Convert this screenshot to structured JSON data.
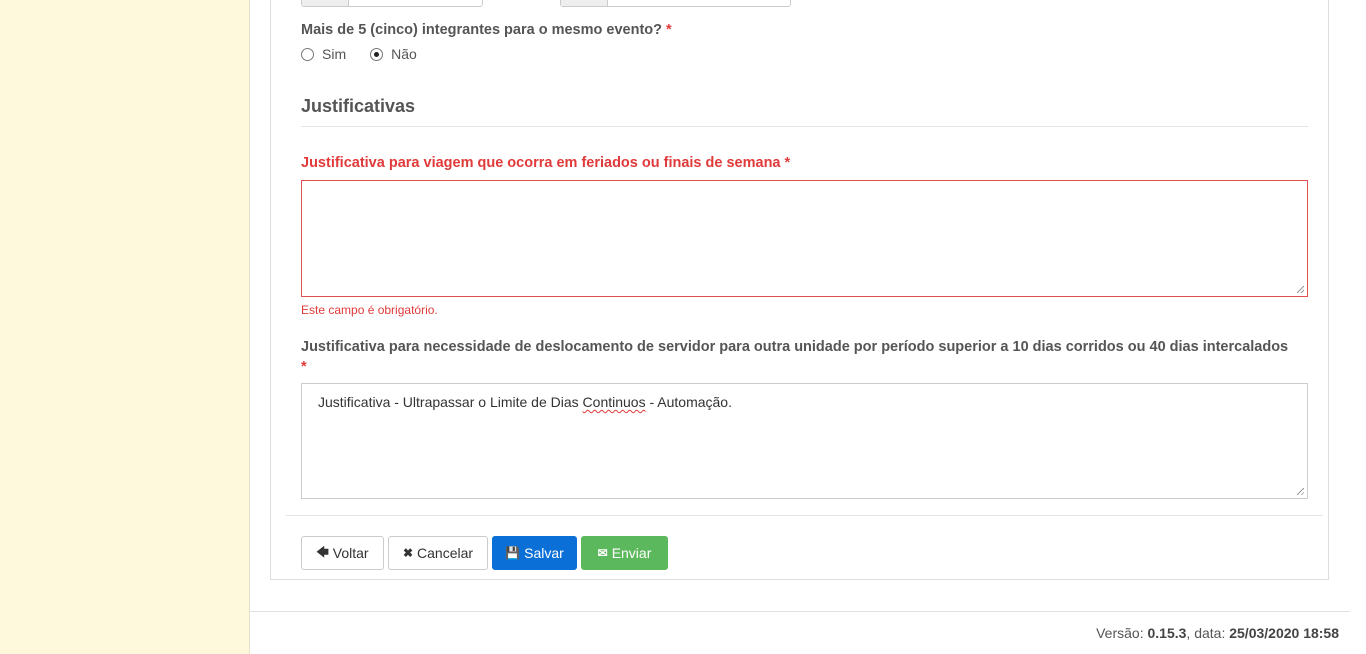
{
  "question": {
    "label": "Mais de 5 (cinco) integrantes para o mesmo evento?",
    "required_mark": "*",
    "options": [
      {
        "label": "Sim",
        "checked": false
      },
      {
        "label": "Não",
        "checked": true
      }
    ]
  },
  "section": {
    "title": "Justificativas"
  },
  "field_feriados": {
    "label": "Justificativa para viagem que ocorra em feriados ou finais de semana",
    "required_mark": "*",
    "value": "",
    "error": "Este campo é obrigatório."
  },
  "field_deslocamento": {
    "label": "Justificativa para necessidade de deslocamento de servidor para outra unidade por período superior a 10 dias corridos ou 40 dias intercalados",
    "required_mark": "*",
    "value_before": "Justificativa - Ultrapassar o Limite de Dias ",
    "value_misspelled": "Continuos",
    "value_after": " - Automação."
  },
  "buttons": {
    "back": {
      "label": "Voltar",
      "icon": "arrow-left-icon"
    },
    "cancel": {
      "label": "Cancelar",
      "icon": "times-icon"
    },
    "save": {
      "label": "Salvar",
      "icon": "floppy-disk-icon"
    },
    "send": {
      "label": "Enviar",
      "icon": "envelope-icon"
    }
  },
  "footer": {
    "version_label": "Versão:",
    "version": "0.15.3",
    "date_label": ", data:",
    "date": "25/03/2020 18:58"
  },
  "colors": {
    "sidebar": "#fef8dd",
    "error": "#e03a3a",
    "primary": "#0a6fd6",
    "success": "#5cb85c"
  }
}
